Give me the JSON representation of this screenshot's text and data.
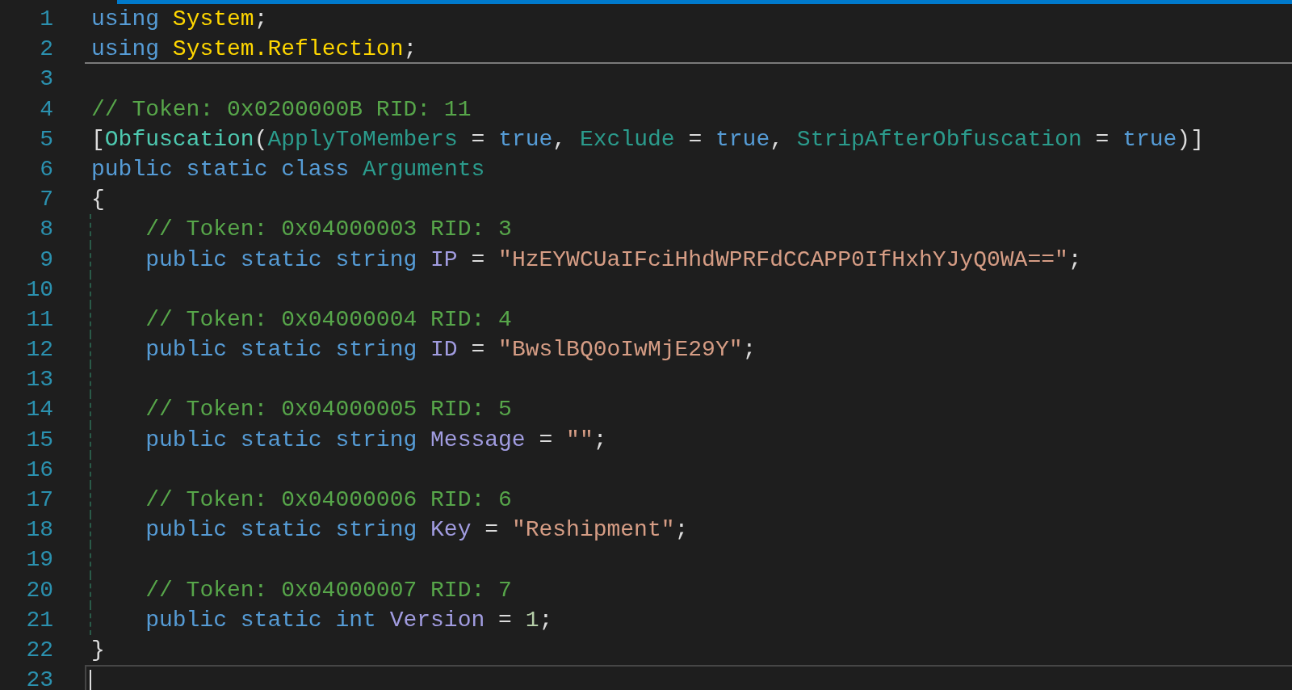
{
  "editor": {
    "lines": [
      {
        "number": "1",
        "current": false,
        "divider_below": false,
        "tokens": [
          {
            "text": "using ",
            "kind": "keyword"
          },
          {
            "text": "System",
            "kind": "namespace"
          },
          {
            "text": ";",
            "kind": "plain"
          }
        ]
      },
      {
        "number": "2",
        "current": false,
        "divider_below": true,
        "tokens": [
          {
            "text": "using ",
            "kind": "keyword"
          },
          {
            "text": "System.Reflection",
            "kind": "namespace"
          },
          {
            "text": ";",
            "kind": "plain"
          }
        ]
      },
      {
        "number": "3",
        "current": false,
        "divider_below": false
      },
      {
        "number": "4",
        "current": false,
        "divider_below": false,
        "tokens": [
          {
            "text": "// Token: 0x0200000B RID: 11",
            "kind": "comment"
          }
        ]
      },
      {
        "number": "5",
        "current": false,
        "divider_below": false,
        "tokens": [
          {
            "text": "[",
            "kind": "plain"
          },
          {
            "text": "Obfuscation",
            "kind": "attribute"
          },
          {
            "text": "(",
            "kind": "plain"
          },
          {
            "text": "ApplyToMembers",
            "kind": "type"
          },
          {
            "text": " = ",
            "kind": "plain"
          },
          {
            "text": "true",
            "kind": "keyword"
          },
          {
            "text": ", ",
            "kind": "plain"
          },
          {
            "text": "Exclude",
            "kind": "type"
          },
          {
            "text": " = ",
            "kind": "plain"
          },
          {
            "text": "true",
            "kind": "keyword"
          },
          {
            "text": ", ",
            "kind": "plain"
          },
          {
            "text": "StripAfterObfuscation",
            "kind": "type"
          },
          {
            "text": " = ",
            "kind": "plain"
          },
          {
            "text": "true",
            "kind": "keyword"
          },
          {
            "text": ")]",
            "kind": "plain"
          }
        ]
      },
      {
        "number": "6",
        "current": false,
        "divider_below": false,
        "tokens": [
          {
            "text": "public static class ",
            "kind": "keyword"
          },
          {
            "text": "Arguments",
            "kind": "type"
          }
        ]
      },
      {
        "number": "7",
        "current": false,
        "divider_below": false,
        "tokens": [
          {
            "text": "{",
            "kind": "plain"
          }
        ],
        "children": [
          {
            "number": "8",
            "current": false,
            "divider_below": false,
            "tokens": [
              {
                "text": "// Token: 0x04000003 RID: 3",
                "kind": "comment"
              }
            ]
          },
          {
            "number": "9",
            "current": false,
            "divider_below": false,
            "tokens": [
              {
                "text": "public static string ",
                "kind": "keyword"
              },
              {
                "text": "IP",
                "kind": "field"
              },
              {
                "text": " = ",
                "kind": "plain"
              },
              {
                "text": "\"HzEYWCUaIFciHhdWPRFdCCAPP0IfHxhYJyQ0WA==\"",
                "kind": "string"
              },
              {
                "text": ";",
                "kind": "plain"
              }
            ]
          },
          {
            "number": "10",
            "current": false,
            "divider_below": false
          },
          {
            "number": "11",
            "current": false,
            "divider_below": false,
            "tokens": [
              {
                "text": "// Token: 0x04000004 RID: 4",
                "kind": "comment"
              }
            ]
          },
          {
            "number": "12",
            "current": false,
            "divider_below": false,
            "tokens": [
              {
                "text": "public static string ",
                "kind": "keyword"
              },
              {
                "text": "ID",
                "kind": "field"
              },
              {
                "text": " = ",
                "kind": "plain"
              },
              {
                "text": "\"BwslBQ0oIwMjE29Y\"",
                "kind": "string"
              },
              {
                "text": ";",
                "kind": "plain"
              }
            ]
          },
          {
            "number": "13",
            "current": false,
            "divider_below": false
          },
          {
            "number": "14",
            "current": false,
            "divider_below": false,
            "tokens": [
              {
                "text": "// Token: 0x04000005 RID: 5",
                "kind": "comment"
              }
            ]
          },
          {
            "number": "15",
            "current": false,
            "divider_below": false,
            "tokens": [
              {
                "text": "public static string ",
                "kind": "keyword"
              },
              {
                "text": "Message",
                "kind": "field"
              },
              {
                "text": " = ",
                "kind": "plain"
              },
              {
                "text": "\"\"",
                "kind": "string"
              },
              {
                "text": ";",
                "kind": "plain"
              }
            ]
          },
          {
            "number": "16",
            "current": false,
            "divider_below": false
          },
          {
            "number": "17",
            "current": false,
            "divider_below": false,
            "tokens": [
              {
                "text": "// Token: 0x04000006 RID: 6",
                "kind": "comment"
              }
            ]
          },
          {
            "number": "18",
            "current": false,
            "divider_below": false,
            "tokens": [
              {
                "text": "public static string ",
                "kind": "keyword"
              },
              {
                "text": "Key",
                "kind": "field"
              },
              {
                "text": " = ",
                "kind": "plain"
              },
              {
                "text": "\"Reshipment\"",
                "kind": "string"
              },
              {
                "text": ";",
                "kind": "plain"
              }
            ]
          },
          {
            "number": "19",
            "current": false,
            "divider_below": false
          },
          {
            "number": "20",
            "current": false,
            "divider_below": false,
            "tokens": [
              {
                "text": "// Token: 0x04000007 RID: 7",
                "kind": "comment"
              }
            ]
          },
          {
            "number": "21",
            "current": false,
            "divider_below": false,
            "tokens": [
              {
                "text": "public static int ",
                "kind": "keyword"
              },
              {
                "text": "Version",
                "kind": "field"
              },
              {
                "text": " = ",
                "kind": "plain"
              },
              {
                "text": "1",
                "kind": "number"
              },
              {
                "text": ";",
                "kind": "plain"
              }
            ]
          }
        ]
      },
      {
        "number": "22",
        "current": false,
        "divider_below": false,
        "tokens": [
          {
            "text": "}",
            "kind": "plain"
          }
        ]
      },
      {
        "number": "23",
        "current": true,
        "divider_below": false
      }
    ]
  }
}
